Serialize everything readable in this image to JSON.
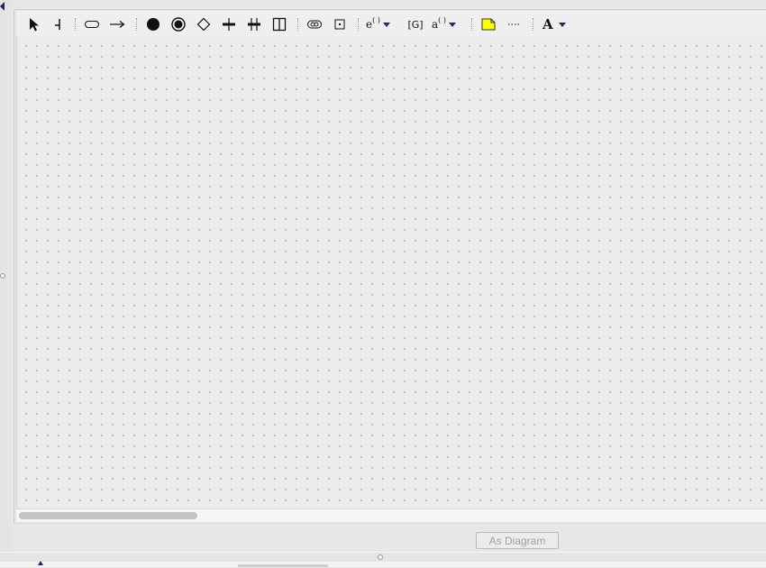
{
  "toolbar": {
    "tools": [
      {
        "name": "select-tool",
        "icon": "arrow-pointer-icon"
      },
      {
        "name": "lifeline-tool",
        "icon": "lifeline-icon"
      },
      {
        "name": "state-tool",
        "icon": "rounded-rect-icon"
      },
      {
        "name": "transition-tool",
        "icon": "right-arrow-icon"
      },
      {
        "name": "initial-state-tool",
        "icon": "filled-circle-icon"
      },
      {
        "name": "final-state-tool",
        "icon": "bullseye-icon"
      },
      {
        "name": "choice-tool",
        "icon": "diamond-icon"
      },
      {
        "name": "fork-tool",
        "icon": "fork-bar-icon"
      },
      {
        "name": "join-tool",
        "icon": "join-bar-icon"
      },
      {
        "name": "concurrent-region-tool",
        "icon": "split-box-icon"
      },
      {
        "name": "submachine-tool",
        "icon": "oval-state-icon"
      },
      {
        "name": "box-state-tool",
        "icon": "small-box-icon"
      },
      {
        "name": "entry-action-tool",
        "icon": "entry-action-icon"
      },
      {
        "name": "guard-tool",
        "icon": "guard-icon"
      },
      {
        "name": "action-tool",
        "icon": "action-icon"
      },
      {
        "name": "note-tool",
        "icon": "note-icon"
      },
      {
        "name": "note-link-tool",
        "icon": "dotted-line-icon"
      },
      {
        "name": "font-tool",
        "icon": "font-a-icon"
      }
    ],
    "entry_label": "e",
    "entry_sup": "( )",
    "guard_label": "[G]",
    "action_label": "a",
    "action_sup": "( )",
    "font_label": "A"
  },
  "canvas": {
    "grid": true,
    "background": "#ebebeb",
    "dot_color": "#b3b3b3"
  },
  "footer": {
    "diagram_button_label": "As Diagram"
  },
  "colors": {
    "note_fill": "#ffff00",
    "dropdown_arrow": "#1a2b6a"
  }
}
